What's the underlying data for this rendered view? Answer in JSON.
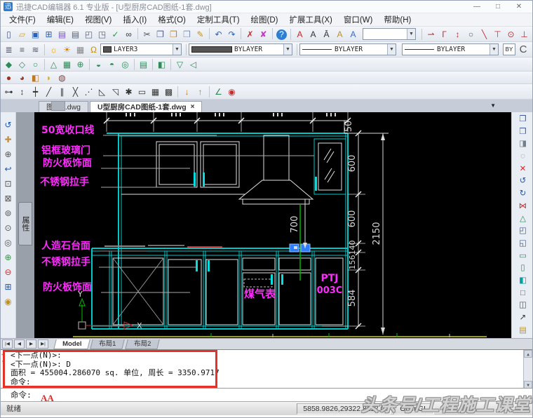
{
  "window": {
    "title": "迅捷CAD编辑器 6.1 专业版 - [U型厨房CAD图纸-1套.dwg]",
    "logo": "迅",
    "controls": [
      {
        "name": "minimize-button",
        "glyph": "—"
      },
      {
        "name": "maximize-button",
        "glyph": "□"
      },
      {
        "name": "close-button",
        "glyph": "✕"
      }
    ]
  },
  "menubar": {
    "items": [
      {
        "name": "menu-file",
        "label": "文件(F)"
      },
      {
        "name": "menu-edit",
        "label": "编辑(E)"
      },
      {
        "name": "menu-view",
        "label": "视图(V)"
      },
      {
        "name": "menu-insert",
        "label": "插入(I)"
      },
      {
        "name": "menu-format",
        "label": "格式(O)"
      },
      {
        "name": "menu-custom-tools",
        "label": "定制工具(T)"
      },
      {
        "name": "menu-draw",
        "label": "绘图(D)"
      },
      {
        "name": "menu-express-tools",
        "label": "扩展工具(X)"
      },
      {
        "name": "menu-window",
        "label": "窗口(W)"
      },
      {
        "name": "menu-help",
        "label": "帮助(H)"
      }
    ]
  },
  "toolbar1": {
    "file_icons": [
      {
        "name": "new-icon",
        "glyph": "▯",
        "color": "#4a5a8a"
      },
      {
        "name": "open-icon",
        "glyph": "▱",
        "color": "#D9A520"
      },
      {
        "name": "save-icon",
        "glyph": "▣",
        "color": "#2A62B8"
      },
      {
        "name": "export-icon",
        "glyph": "⊞",
        "color": "#2A62B8"
      },
      {
        "name": "print-icon",
        "glyph": "▤",
        "color": "#7A5AB8"
      },
      {
        "name": "plot-icon",
        "glyph": "▤",
        "color": "#55607A"
      },
      {
        "name": "print-preview-icon",
        "glyph": "◰",
        "color": "#55607A"
      },
      {
        "name": "publish-icon",
        "glyph": "◳",
        "color": "#55607A"
      },
      {
        "name": "spell-check-icon",
        "glyph": "✓",
        "color": "#2A9A3A"
      },
      {
        "name": "find-icon",
        "glyph": "∞",
        "color": "#333333"
      },
      {
        "name": "separator",
        "sep": true
      },
      {
        "name": "cut-icon",
        "glyph": "✂",
        "color": "#555555"
      },
      {
        "name": "copy-icon",
        "glyph": "❐",
        "color": "#4a5a8a"
      },
      {
        "name": "paste-icon",
        "glyph": "❒",
        "color": "#C08030"
      },
      {
        "name": "paste-special-icon",
        "glyph": "❒",
        "color": "#8090B0"
      },
      {
        "name": "format-painter-icon",
        "glyph": "✎",
        "color": "#C09020"
      },
      {
        "name": "separator",
        "sep": true
      },
      {
        "name": "undo-icon",
        "glyph": "↶",
        "color": "#2A62B8"
      },
      {
        "name": "redo-icon",
        "glyph": "↷",
        "color": "#2A62B8"
      },
      {
        "name": "separator",
        "sep": true
      },
      {
        "name": "delete-icon",
        "glyph": "✗",
        "color": "#D22828"
      },
      {
        "name": "purge-icon",
        "glyph": "✘",
        "color": "#C238C2"
      },
      {
        "name": "separator",
        "sep": true
      },
      {
        "name": "help-icon",
        "glyph": "?",
        "color": "#ffffff",
        "bg": "#2D7DD2"
      }
    ],
    "text_icons": [
      {
        "name": "text-style-icon",
        "glyph": "A",
        "color": "#C22828"
      },
      {
        "name": "single-text-icon",
        "glyph": "A",
        "color": "#333333"
      },
      {
        "name": "multiline-text-icon",
        "glyph": "Ā",
        "color": "#333333"
      },
      {
        "name": "edit-text-icon",
        "glyph": "A",
        "color": "#C09020"
      },
      {
        "name": "text-scale-icon",
        "glyph": "A",
        "color": "#3A6AC0"
      }
    ],
    "style_combo": {
      "value": ""
    },
    "snap_icons": [
      {
        "name": "snap-endpoint-icon",
        "glyph": "⇀",
        "color": "#C03030"
      },
      {
        "name": "snap-midpoint-icon",
        "glyph": "Γ",
        "color": "#C03030"
      },
      {
        "name": "snap-intersection-icon",
        "glyph": "↕",
        "color": "#C03030"
      },
      {
        "name": "snap-center-icon",
        "glyph": "○",
        "color": "#C03030"
      },
      {
        "name": "snap-nearest-icon",
        "glyph": "╲",
        "color": "#C03030"
      },
      {
        "name": "snap-extension-icon",
        "glyph": "⊤",
        "color": "#C03030"
      },
      {
        "name": "snap-node-icon",
        "glyph": "⊙",
        "color": "#C03030"
      },
      {
        "name": "snap-perpendicular-icon",
        "glyph": "⊥",
        "color": "#C03030"
      },
      {
        "name": "snap-tangent-icon",
        "glyph": "⌒",
        "color": "#C03030"
      }
    ]
  },
  "toolbar2": {
    "layer_icons": [
      {
        "name": "layer-manager-icon",
        "glyph": "≣",
        "color": "#555566"
      },
      {
        "name": "layer-states-icon",
        "glyph": "≡",
        "color": "#555566"
      },
      {
        "name": "layer-match-icon",
        "glyph": "≋",
        "color": "#555566"
      }
    ],
    "light_icons": [
      {
        "name": "layer-on-icon",
        "glyph": "☼",
        "color": "#E0A000"
      },
      {
        "name": "layer-thaw-icon",
        "glyph": "☀",
        "color": "#E08000"
      },
      {
        "name": "layer-viewport-icon",
        "glyph": "▦",
        "color": "#888888"
      },
      {
        "name": "layer-lock-icon",
        "glyph": "Ω",
        "color": "#C09020"
      }
    ],
    "layer_combo": {
      "value": "LAYER3"
    },
    "color_combo": {
      "value": "BYLAYER"
    },
    "linetype_combo": {
      "value": "BYLAYER"
    },
    "lineweight_combo": {
      "value": "BYLAYER"
    },
    "by_button": "BY",
    "arc_icon": "C"
  },
  "toolbar3": {
    "icons": [
      {
        "name": "solid-box-icon",
        "glyph": "◆",
        "color": "#2E8B57"
      },
      {
        "name": "solid-wedge-icon",
        "glyph": "◇",
        "color": "#2E8B57"
      },
      {
        "name": "solid-cylinder-icon",
        "glyph": "○",
        "color": "#2E8B57"
      },
      {
        "name": "separator",
        "sep": true
      },
      {
        "name": "solid-cone-icon",
        "glyph": "△",
        "color": "#2E8B57"
      },
      {
        "name": "solid-mesh-icon",
        "glyph": "▦",
        "color": "#2E8B57"
      },
      {
        "name": "solid-sphere-icon",
        "glyph": "⊕",
        "color": "#2E8B57"
      },
      {
        "name": "separator",
        "sep": true
      },
      {
        "name": "solid-dome-icon",
        "glyph": "◒",
        "color": "#2E8B57"
      },
      {
        "name": "solid-dish-icon",
        "glyph": "◓",
        "color": "#2E8B57"
      },
      {
        "name": "solid-torus-icon",
        "glyph": "◎",
        "color": "#2E8B57"
      },
      {
        "name": "separator",
        "sep": true
      },
      {
        "name": "solid-extrude-icon",
        "glyph": "▤",
        "color": "#2E8B57"
      },
      {
        "name": "separator",
        "sep": true
      },
      {
        "name": "solid-section-icon",
        "glyph": "◧",
        "color": "#2E8B57"
      },
      {
        "name": "separator",
        "sep": true
      },
      {
        "name": "solid-revolve-icon",
        "glyph": "▽",
        "color": "#2E8B57"
      },
      {
        "name": "solid-slice-icon",
        "glyph": "◁",
        "color": "#2E8B57"
      }
    ]
  },
  "toolbar4": {
    "icons": [
      {
        "name": "render-icon",
        "glyph": "●",
        "color": "#A03020"
      },
      {
        "name": "render-region-icon",
        "glyph": "◕",
        "color": "#A03020"
      },
      {
        "name": "materials-icon",
        "glyph": "◧",
        "color": "#C07820"
      },
      {
        "name": "lights-icon",
        "glyph": "◗",
        "color": "#D4B020"
      },
      {
        "name": "render-save-icon",
        "glyph": "◍",
        "color": "#904038"
      }
    ]
  },
  "toolbar5": {
    "icons": [
      {
        "name": "point-icon",
        "glyph": "⊶",
        "color": "#333333"
      },
      {
        "name": "point-divide-icon",
        "glyph": "↕",
        "color": "#333333"
      },
      {
        "name": "point-measure-icon",
        "glyph": "┿",
        "color": "#333333"
      },
      {
        "name": "line-icon",
        "glyph": "╱",
        "color": "#333333"
      },
      {
        "name": "parallel-line-icon",
        "glyph": "∥",
        "color": "#333333"
      },
      {
        "name": "construction-line-icon",
        "glyph": "╳",
        "color": "#333333"
      },
      {
        "name": "ray-icon",
        "glyph": "⋰",
        "color": "#333333"
      },
      {
        "name": "polygon-icon",
        "glyph": "◺",
        "color": "#333333"
      },
      {
        "name": "rectangle-icon",
        "glyph": "◹",
        "color": "#333333"
      },
      {
        "name": "multiple-point-icon",
        "glyph": "✱",
        "color": "#333333"
      },
      {
        "name": "region-icon",
        "glyph": "▭",
        "color": "#333333"
      },
      {
        "name": "table-icon",
        "glyph": "▦",
        "color": "#333333"
      },
      {
        "name": "hatch-icon",
        "glyph": "▩",
        "color": "#333333"
      },
      {
        "name": "separator",
        "sep": true
      },
      {
        "name": "leader-icon",
        "glyph": "↓",
        "color": "#C07820"
      },
      {
        "name": "quick-leader-icon",
        "glyph": "↑",
        "color": "#C07820"
      },
      {
        "name": "separator",
        "sep": true
      },
      {
        "name": "dim-angle-icon",
        "glyph": "∠",
        "color": "#2E8B57"
      },
      {
        "name": "dim-center-icon",
        "glyph": "◉",
        "color": "#C03030"
      }
    ]
  },
  "doc_tabs": {
    "tabs": [
      {
        "name": "tab-sheet1",
        "label": "图纸1.dwg"
      },
      {
        "name": "tab-kitchen-drawing",
        "label": "U型厨房CAD图纸-1套.dwg",
        "close": "×",
        "active": true
      }
    ],
    "menu_arrow": "▼"
  },
  "side_left": {
    "icons": [
      {
        "name": "regen-icon",
        "glyph": "↺",
        "color": "#2255AA"
      },
      {
        "name": "pan-icon",
        "glyph": "✚",
        "color": "#C09048"
      },
      {
        "name": "zoom-realtime-icon",
        "glyph": "⊕",
        "color": "#555555"
      },
      {
        "name": "zoom-previous-icon",
        "glyph": "↩",
        "color": "#2255AA"
      },
      {
        "name": "zoom-window-icon",
        "glyph": "⊡",
        "color": "#555555"
      },
      {
        "name": "zoom-dynamic-icon",
        "glyph": "⊠",
        "color": "#555555"
      },
      {
        "name": "zoom-scale-icon",
        "glyph": "⊚",
        "color": "#555555"
      },
      {
        "name": "zoom-center-icon",
        "glyph": "⊙",
        "color": "#555555"
      },
      {
        "name": "zoom-object-icon",
        "glyph": "◎",
        "color": "#555555"
      },
      {
        "name": "zoom-in-icon",
        "glyph": "⊕",
        "color": "#2A9A3A"
      },
      {
        "name": "zoom-out-icon",
        "glyph": "⊖",
        "color": "#C03030"
      },
      {
        "name": "zoom-extents-icon",
        "glyph": "⊞",
        "color": "#2255AA"
      },
      {
        "name": "show-hide-icon",
        "glyph": "◉",
        "color": "#C09020"
      }
    ],
    "properties_tab": "属性"
  },
  "side_right": {
    "icons": [
      {
        "name": "copy-object-icon",
        "glyph": "❐",
        "color": "#3A5AA0"
      },
      {
        "name": "copy-multiple-icon",
        "glyph": "❒",
        "color": "#3A5AA0"
      },
      {
        "name": "paste-block-icon",
        "glyph": "◨",
        "color": "#708090"
      },
      {
        "name": "select-window-icon",
        "glyph": "◌",
        "color": "#708090"
      },
      {
        "name": "erase-icon",
        "glyph": "✕",
        "color": "#D22828"
      },
      {
        "name": "rotate-ccw-icon",
        "glyph": "↺",
        "color": "#2255AA"
      },
      {
        "name": "rotate-cw-icon",
        "glyph": "↻",
        "color": "#2255AA"
      },
      {
        "name": "mirror-icon",
        "glyph": "⋈",
        "color": "#C03030"
      },
      {
        "name": "array-icon",
        "glyph": "△",
        "color": "#2E8B57"
      },
      {
        "name": "stretch-icon",
        "glyph": "◰",
        "color": "#3A5AA0"
      },
      {
        "name": "scale-icon",
        "glyph": "◱",
        "color": "#3A5AA0"
      },
      {
        "name": "region-create-icon",
        "glyph": "▭",
        "color": "#2E8B57"
      },
      {
        "name": "boundary-icon",
        "glyph": "▯",
        "color": "#2E8B57"
      },
      {
        "name": "union-icon",
        "glyph": "◧",
        "color": "#00A0A0"
      },
      {
        "name": "box-3d-icon",
        "glyph": "□",
        "color": "#555555"
      },
      {
        "name": "subtract-icon",
        "glyph": "◫",
        "color": "#555555"
      },
      {
        "name": "polyline-edit-icon",
        "glyph": "↗",
        "color": "#333333"
      },
      {
        "name": "hatch-edit-icon",
        "glyph": "▤",
        "color": "#C09020"
      }
    ]
  },
  "drawing": {
    "labels": {
      "shoukouxian": "50宽收口线",
      "bolimen": "铝框玻璃门",
      "fanghuoban_top": "防火板饰面",
      "lashou_top": "不锈钢拉手",
      "taimian": "人造石台面",
      "lashou_bottom": "不锈钢拉手",
      "fanghuoban_bottom": "防火板饰面",
      "meiqibiao": "煤气表",
      "ptj_line1": "PTJ",
      "ptj_line2": "003C"
    },
    "dims": {
      "d50": "50",
      "d600a": "600",
      "d600b": "600",
      "d140": "140",
      "d156": "156",
      "d584": "584",
      "total": "2150",
      "d700": "700"
    },
    "ucs": {
      "x": "X",
      "y": "Y"
    }
  },
  "layout_tabs": {
    "nav": [
      {
        "name": "first-layout-button",
        "glyph": "|◀"
      },
      {
        "name": "prev-layout-button",
        "glyph": "◀"
      },
      {
        "name": "next-layout-button",
        "glyph": "▶"
      },
      {
        "name": "last-layout-button",
        "glyph": "▶|"
      }
    ],
    "tabs": [
      {
        "name": "tab-model",
        "label": "Model",
        "active": true
      },
      {
        "name": "tab-layout1",
        "label": "布局1"
      },
      {
        "name": "tab-layout2",
        "label": "布局2"
      }
    ]
  },
  "command": {
    "history": [
      "<下一点(N)>:",
      "<下一点(N)>: D",
      "面积 = 455004.286070 sq. 单位, 周长 = 3350.9717",
      "命令:"
    ],
    "prompt": "命令:",
    "annotation": "AA"
  },
  "statusbar": {
    "ready": "就绪",
    "coords": "5858.9826,29322.8112,0",
    "renderer": "OpenGL"
  },
  "watermark": {
    "text": "头条号/工程施工课堂"
  }
}
